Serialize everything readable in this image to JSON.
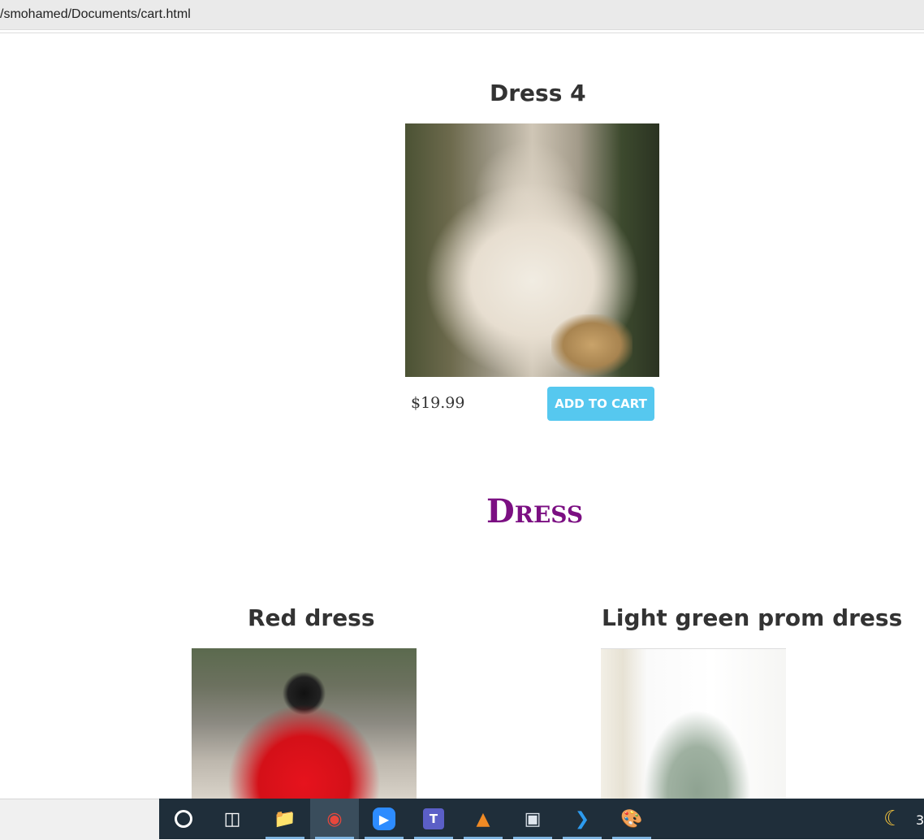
{
  "browser": {
    "address": "/smohamed/Documents/cart.html"
  },
  "products_top": {
    "title": "Dress 4",
    "price": "$19.99",
    "button_label": "ADD TO CART"
  },
  "section": {
    "title": "Dress"
  },
  "products_grid": [
    {
      "title": "Red dress"
    },
    {
      "title": "Light green prom dress"
    }
  ],
  "taskbar": {
    "items": [
      {
        "name": "cortana",
        "icon": "circle-icon"
      },
      {
        "name": "task-view",
        "icon": "task-view-icon"
      },
      {
        "name": "file-explorer",
        "icon": "folder-icon"
      },
      {
        "name": "chrome",
        "icon": "chrome-icon"
      },
      {
        "name": "zoom",
        "icon": "zoom-icon"
      },
      {
        "name": "teams",
        "icon": "teams-icon"
      },
      {
        "name": "vlc",
        "icon": "vlc-icon"
      },
      {
        "name": "media-player",
        "icon": "media-player-icon"
      },
      {
        "name": "vscode",
        "icon": "vscode-icon"
      },
      {
        "name": "paint",
        "icon": "paint-icon"
      }
    ],
    "clock_partial": "3"
  },
  "colors": {
    "button": "#56c8ef",
    "section_title": "#7b0f82",
    "taskbar": "#1f2e3a"
  }
}
